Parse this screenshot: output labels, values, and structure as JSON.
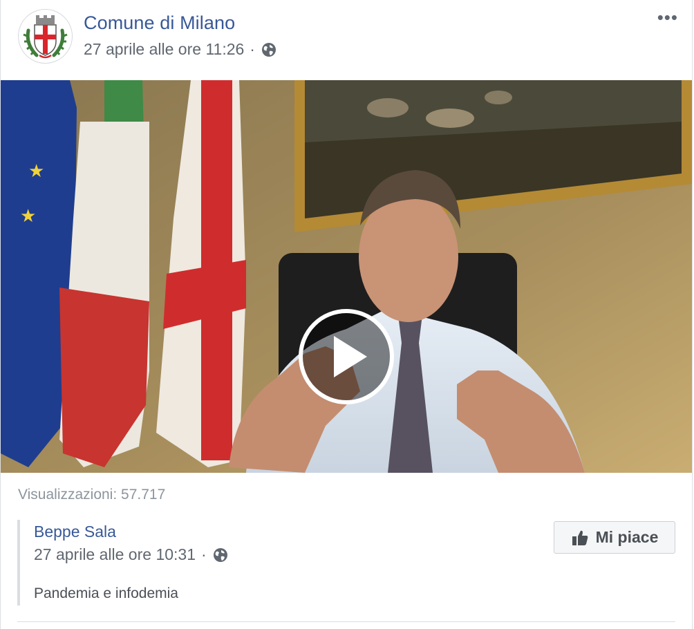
{
  "post": {
    "page_name": "Comune di Milano",
    "timestamp": "27 aprile alle ore 11:26",
    "separator": "·",
    "privacy_icon": "globe-icon",
    "more_label": "•••"
  },
  "video": {
    "play_icon": "play-icon",
    "views_text": "Visualizzazioni: 57.717"
  },
  "shared": {
    "author": "Beppe Sala",
    "timestamp": "27 aprile alle ore 10:31",
    "separator": "·",
    "text": "Pandemia e infodemia",
    "like_button_label": "Mi piace",
    "like_icon": "thumbs-up-icon"
  },
  "colors": {
    "link": "#385898",
    "secondary_text": "#606770",
    "muted_text": "#8d949e"
  }
}
